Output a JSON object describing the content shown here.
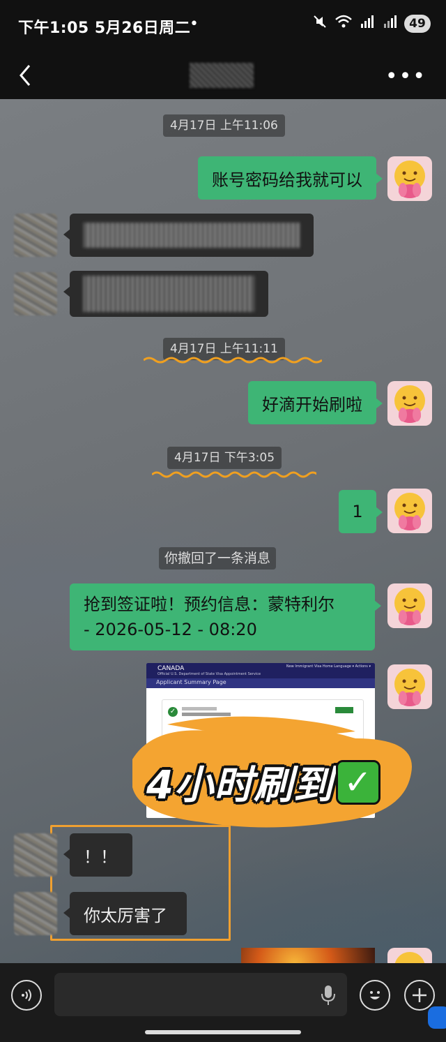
{
  "status_bar": {
    "time": "下午1:05  5月26日周二",
    "dot": "•",
    "battery": "49"
  },
  "header": {
    "more": "•••"
  },
  "messages": {
    "time1": "4月17日 上午11:06",
    "msg1": "账号密码给我就可以",
    "time2": "4月17日 上午11:11",
    "msg2": "好滴开始刷啦",
    "time3": "4月17日 下午3:05",
    "msg3": "1",
    "recall": "你撤回了一条消息",
    "msg4_line1": "抢到签证啦！预约信息：蒙特利尔",
    "msg4_line2": "- 2026-05-12 - 08:20",
    "reply1": "！！",
    "reply2": "你太厉害了"
  },
  "screenshot": {
    "country": "CANADA",
    "subtitle": "Official U.S. Department of State Visa Appointment Service",
    "page_title": "Applicant Summary Page",
    "nav": "New Immigrant Visa    Home    Language ▾    Actions ▾"
  },
  "overlay": {
    "text": "4小时刷到",
    "check": "✓"
  },
  "colors": {
    "bubble_me": "#3eb575",
    "bubble_other": "#2b2b2b",
    "highlight": "#f0a030",
    "squiggle": "#f0a020"
  },
  "icons": [
    "back-arrow-icon",
    "more-icon",
    "mute-icon",
    "wifi-icon",
    "signal-icon",
    "voice-icon",
    "mic-icon",
    "emoji-icon",
    "plus-icon"
  ]
}
